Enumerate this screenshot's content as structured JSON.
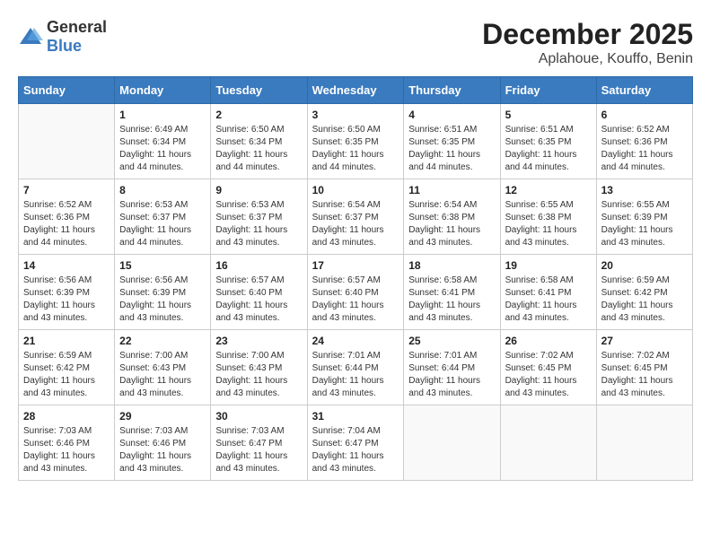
{
  "logo": {
    "general": "General",
    "blue": "Blue"
  },
  "header": {
    "month": "December 2025",
    "location": "Aplahoue, Kouffo, Benin"
  },
  "weekdays": [
    "Sunday",
    "Monday",
    "Tuesday",
    "Wednesday",
    "Thursday",
    "Friday",
    "Saturday"
  ],
  "weeks": [
    [
      {
        "day": "",
        "sunrise": "",
        "sunset": "",
        "daylight": ""
      },
      {
        "day": "1",
        "sunrise": "Sunrise: 6:49 AM",
        "sunset": "Sunset: 6:34 PM",
        "daylight": "Daylight: 11 hours and 44 minutes."
      },
      {
        "day": "2",
        "sunrise": "Sunrise: 6:50 AM",
        "sunset": "Sunset: 6:34 PM",
        "daylight": "Daylight: 11 hours and 44 minutes."
      },
      {
        "day": "3",
        "sunrise": "Sunrise: 6:50 AM",
        "sunset": "Sunset: 6:35 PM",
        "daylight": "Daylight: 11 hours and 44 minutes."
      },
      {
        "day": "4",
        "sunrise": "Sunrise: 6:51 AM",
        "sunset": "Sunset: 6:35 PM",
        "daylight": "Daylight: 11 hours and 44 minutes."
      },
      {
        "day": "5",
        "sunrise": "Sunrise: 6:51 AM",
        "sunset": "Sunset: 6:35 PM",
        "daylight": "Daylight: 11 hours and 44 minutes."
      },
      {
        "day": "6",
        "sunrise": "Sunrise: 6:52 AM",
        "sunset": "Sunset: 6:36 PM",
        "daylight": "Daylight: 11 hours and 44 minutes."
      }
    ],
    [
      {
        "day": "7",
        "sunrise": "Sunrise: 6:52 AM",
        "sunset": "Sunset: 6:36 PM",
        "daylight": "Daylight: 11 hours and 44 minutes."
      },
      {
        "day": "8",
        "sunrise": "Sunrise: 6:53 AM",
        "sunset": "Sunset: 6:37 PM",
        "daylight": "Daylight: 11 hours and 44 minutes."
      },
      {
        "day": "9",
        "sunrise": "Sunrise: 6:53 AM",
        "sunset": "Sunset: 6:37 PM",
        "daylight": "Daylight: 11 hours and 43 minutes."
      },
      {
        "day": "10",
        "sunrise": "Sunrise: 6:54 AM",
        "sunset": "Sunset: 6:37 PM",
        "daylight": "Daylight: 11 hours and 43 minutes."
      },
      {
        "day": "11",
        "sunrise": "Sunrise: 6:54 AM",
        "sunset": "Sunset: 6:38 PM",
        "daylight": "Daylight: 11 hours and 43 minutes."
      },
      {
        "day": "12",
        "sunrise": "Sunrise: 6:55 AM",
        "sunset": "Sunset: 6:38 PM",
        "daylight": "Daylight: 11 hours and 43 minutes."
      },
      {
        "day": "13",
        "sunrise": "Sunrise: 6:55 AM",
        "sunset": "Sunset: 6:39 PM",
        "daylight": "Daylight: 11 hours and 43 minutes."
      }
    ],
    [
      {
        "day": "14",
        "sunrise": "Sunrise: 6:56 AM",
        "sunset": "Sunset: 6:39 PM",
        "daylight": "Daylight: 11 hours and 43 minutes."
      },
      {
        "day": "15",
        "sunrise": "Sunrise: 6:56 AM",
        "sunset": "Sunset: 6:39 PM",
        "daylight": "Daylight: 11 hours and 43 minutes."
      },
      {
        "day": "16",
        "sunrise": "Sunrise: 6:57 AM",
        "sunset": "Sunset: 6:40 PM",
        "daylight": "Daylight: 11 hours and 43 minutes."
      },
      {
        "day": "17",
        "sunrise": "Sunrise: 6:57 AM",
        "sunset": "Sunset: 6:40 PM",
        "daylight": "Daylight: 11 hours and 43 minutes."
      },
      {
        "day": "18",
        "sunrise": "Sunrise: 6:58 AM",
        "sunset": "Sunset: 6:41 PM",
        "daylight": "Daylight: 11 hours and 43 minutes."
      },
      {
        "day": "19",
        "sunrise": "Sunrise: 6:58 AM",
        "sunset": "Sunset: 6:41 PM",
        "daylight": "Daylight: 11 hours and 43 minutes."
      },
      {
        "day": "20",
        "sunrise": "Sunrise: 6:59 AM",
        "sunset": "Sunset: 6:42 PM",
        "daylight": "Daylight: 11 hours and 43 minutes."
      }
    ],
    [
      {
        "day": "21",
        "sunrise": "Sunrise: 6:59 AM",
        "sunset": "Sunset: 6:42 PM",
        "daylight": "Daylight: 11 hours and 43 minutes."
      },
      {
        "day": "22",
        "sunrise": "Sunrise: 7:00 AM",
        "sunset": "Sunset: 6:43 PM",
        "daylight": "Daylight: 11 hours and 43 minutes."
      },
      {
        "day": "23",
        "sunrise": "Sunrise: 7:00 AM",
        "sunset": "Sunset: 6:43 PM",
        "daylight": "Daylight: 11 hours and 43 minutes."
      },
      {
        "day": "24",
        "sunrise": "Sunrise: 7:01 AM",
        "sunset": "Sunset: 6:44 PM",
        "daylight": "Daylight: 11 hours and 43 minutes."
      },
      {
        "day": "25",
        "sunrise": "Sunrise: 7:01 AM",
        "sunset": "Sunset: 6:44 PM",
        "daylight": "Daylight: 11 hours and 43 minutes."
      },
      {
        "day": "26",
        "sunrise": "Sunrise: 7:02 AM",
        "sunset": "Sunset: 6:45 PM",
        "daylight": "Daylight: 11 hours and 43 minutes."
      },
      {
        "day": "27",
        "sunrise": "Sunrise: 7:02 AM",
        "sunset": "Sunset: 6:45 PM",
        "daylight": "Daylight: 11 hours and 43 minutes."
      }
    ],
    [
      {
        "day": "28",
        "sunrise": "Sunrise: 7:03 AM",
        "sunset": "Sunset: 6:46 PM",
        "daylight": "Daylight: 11 hours and 43 minutes."
      },
      {
        "day": "29",
        "sunrise": "Sunrise: 7:03 AM",
        "sunset": "Sunset: 6:46 PM",
        "daylight": "Daylight: 11 hours and 43 minutes."
      },
      {
        "day": "30",
        "sunrise": "Sunrise: 7:03 AM",
        "sunset": "Sunset: 6:47 PM",
        "daylight": "Daylight: 11 hours and 43 minutes."
      },
      {
        "day": "31",
        "sunrise": "Sunrise: 7:04 AM",
        "sunset": "Sunset: 6:47 PM",
        "daylight": "Daylight: 11 hours and 43 minutes."
      },
      {
        "day": "",
        "sunrise": "",
        "sunset": "",
        "daylight": ""
      },
      {
        "day": "",
        "sunrise": "",
        "sunset": "",
        "daylight": ""
      },
      {
        "day": "",
        "sunrise": "",
        "sunset": "",
        "daylight": ""
      }
    ]
  ]
}
